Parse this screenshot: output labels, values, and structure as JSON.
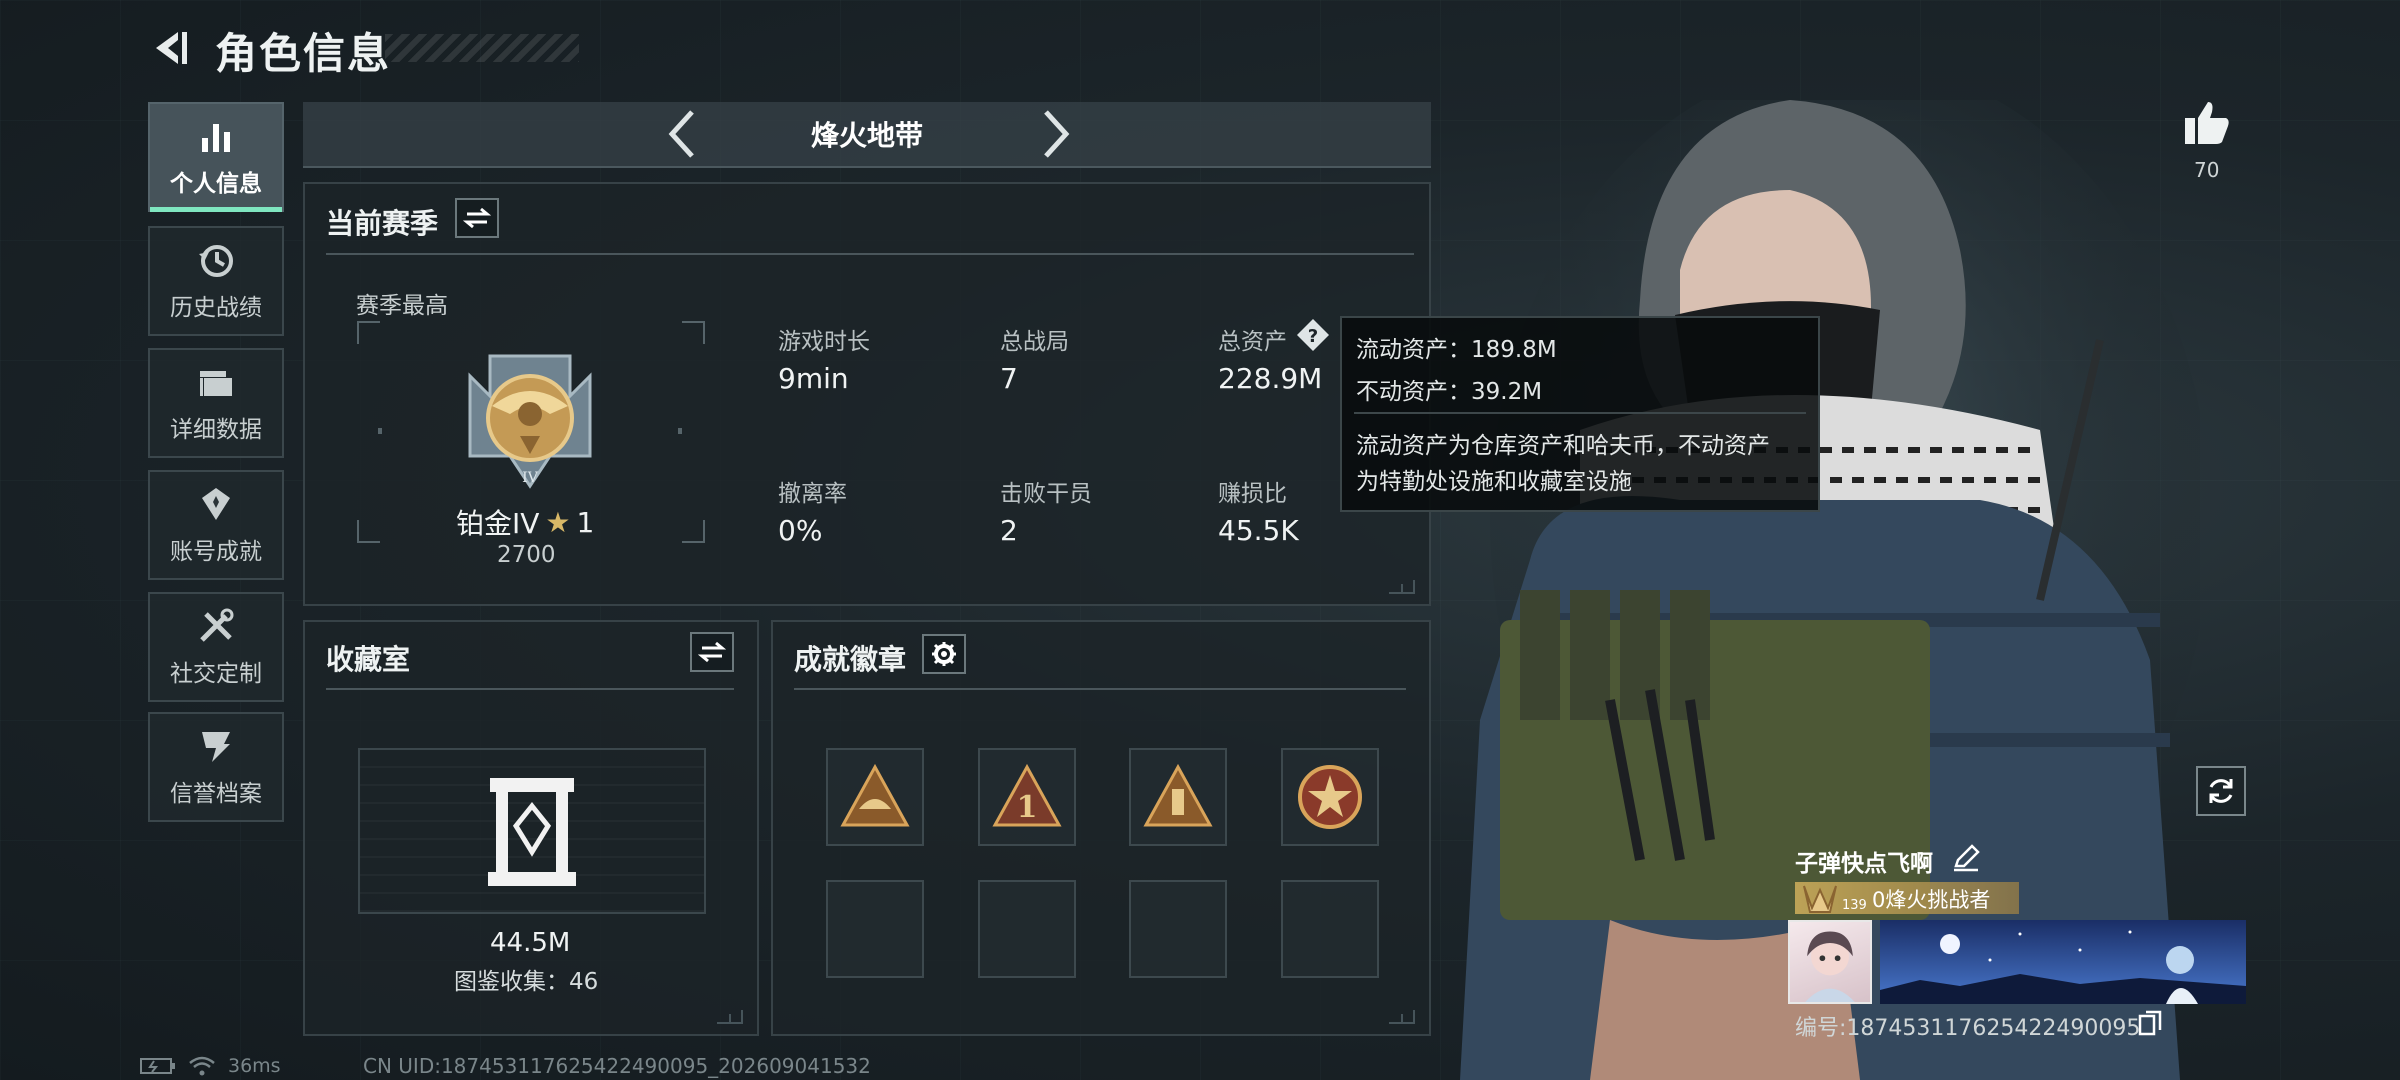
{
  "header": {
    "title": "角色信息"
  },
  "sidebar": {
    "items": [
      {
        "label": "个人信息",
        "icon": "bar-chart-icon",
        "active": true
      },
      {
        "label": "历史战绩",
        "icon": "history-clock-icon",
        "active": false
      },
      {
        "label": "详细数据",
        "icon": "folder-icon",
        "active": false
      },
      {
        "label": "账号成就",
        "icon": "achievement-icon",
        "active": false
      },
      {
        "label": "社交定制",
        "icon": "tools-icon",
        "active": false
      },
      {
        "label": "信誉档案",
        "icon": "credit-icon",
        "active": false
      }
    ]
  },
  "mode_selector": {
    "title": "烽火地带"
  },
  "season": {
    "title": "当前赛季",
    "best_label": "赛季最高",
    "rank_name": "铂金IV",
    "rank_stars": "1",
    "rank_score": "2700",
    "stats": [
      {
        "label": "游戏时长",
        "value": "9min"
      },
      {
        "label": "总战局",
        "value": "7"
      },
      {
        "label": "总资产",
        "value": "228.9M"
      },
      {
        "label": "撤离率",
        "value": "0%"
      },
      {
        "label": "击败干员",
        "value": "2"
      },
      {
        "label": "赚损比",
        "value": "45.5K"
      }
    ]
  },
  "tooltip": {
    "line1": "流动资产：189.8M",
    "line2": "不动资产：39.2M",
    "desc1": "流动资产为仓库资产和哈夫币，不动资产",
    "desc2": "为特勤处设施和收藏室设施"
  },
  "collection": {
    "title": "收藏室",
    "value": "44.5M",
    "count_text": "图鉴收集：46"
  },
  "achievements": {
    "title": "成就徽章"
  },
  "right": {
    "likes": "70",
    "player_name": "子弹快点飞啊",
    "rank_title": "0烽火挑战者",
    "rank_level": "139",
    "serial": "编号:187453117625422490095"
  },
  "status": {
    "ping": "36ms",
    "uid": "CN UID:187453117625422490095_202609041532"
  },
  "colors": {
    "accent": "#7fe6c0",
    "gold": "#c9aa5a",
    "panel": "#1c2428"
  }
}
